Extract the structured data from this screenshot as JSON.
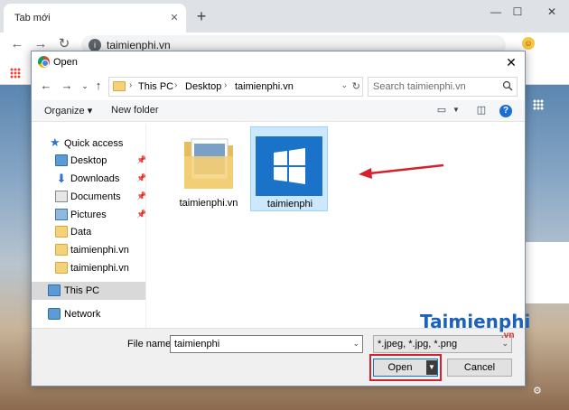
{
  "browser": {
    "tab_title": "Tab mới",
    "url": "taimienphi.vn"
  },
  "dialog": {
    "title": "Open",
    "breadcrumbs": [
      "This PC",
      "Desktop",
      "taimienphi.vn"
    ],
    "search_placeholder": "Search taimienphi.vn",
    "commands": {
      "organize": "Organize",
      "new_folder": "New folder"
    },
    "nav_items": [
      {
        "label": "Quick access",
        "icon": "star-icon"
      },
      {
        "label": "Desktop",
        "icon": "desktop-folder-icon",
        "pinned": true
      },
      {
        "label": "Downloads",
        "icon": "download-icon",
        "pinned": true
      },
      {
        "label": "Documents",
        "icon": "documents-icon",
        "pinned": true
      },
      {
        "label": "Pictures",
        "icon": "pictures-icon",
        "pinned": true
      },
      {
        "label": "Data",
        "icon": "folder-icon"
      },
      {
        "label": "taimienphi.vn",
        "icon": "folder-icon"
      },
      {
        "label": "taimienphi.vn",
        "icon": "folder-icon"
      },
      {
        "label": "This PC",
        "icon": "pc-icon",
        "selected": true
      },
      {
        "label": "Network",
        "icon": "network-icon"
      }
    ],
    "files": [
      {
        "label": "taimienphi.vn",
        "type": "folder"
      },
      {
        "label": "taimienphi",
        "type": "image",
        "selected": true
      }
    ],
    "file_name_label": "File name:",
    "file_name_value": "taimienphi",
    "file_type_filter": "*.jpeg, *.jpg, *.png",
    "open_label": "Open",
    "cancel_label": "Cancel"
  },
  "watermark": {
    "text": "Taimienphi",
    "suffix": ".vn"
  },
  "colors": {
    "highlight": "#d6202c",
    "selection": "#cce8ff",
    "accent": "#0078d7"
  }
}
